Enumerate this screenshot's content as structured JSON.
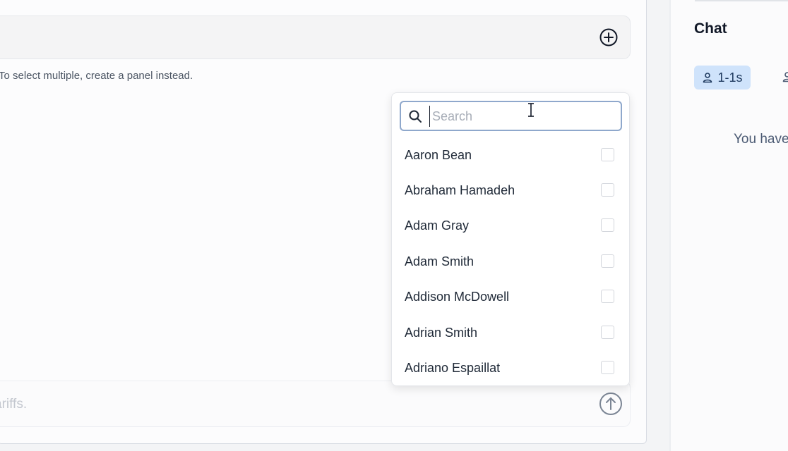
{
  "composer": {
    "helper_text": "To select multiple, create a panel instead.",
    "input_value": "ariffs."
  },
  "chat": {
    "title": "Chat",
    "tab_1on1_label": "1-1s",
    "empty_text": "You have"
  },
  "dropdown": {
    "search_placeholder": "Search",
    "items": [
      {
        "name": "Aaron Bean",
        "checked": false
      },
      {
        "name": "Abraham Hamadeh",
        "checked": false
      },
      {
        "name": "Adam Gray",
        "checked": false
      },
      {
        "name": "Adam Smith",
        "checked": false
      },
      {
        "name": "Addison McDowell",
        "checked": false
      },
      {
        "name": "Adrian Smith",
        "checked": false
      },
      {
        "name": "Adriano Espaillat",
        "checked": false
      }
    ]
  },
  "icons": {
    "add": "plus-circle-icon",
    "send": "arrow-up-circle-icon",
    "search": "search-icon",
    "person": "person-icon",
    "cursor": "text-cursor-icon"
  },
  "colors": {
    "tab_active_bg": "#cfe3fb",
    "search_border": "#8fa8cc"
  }
}
